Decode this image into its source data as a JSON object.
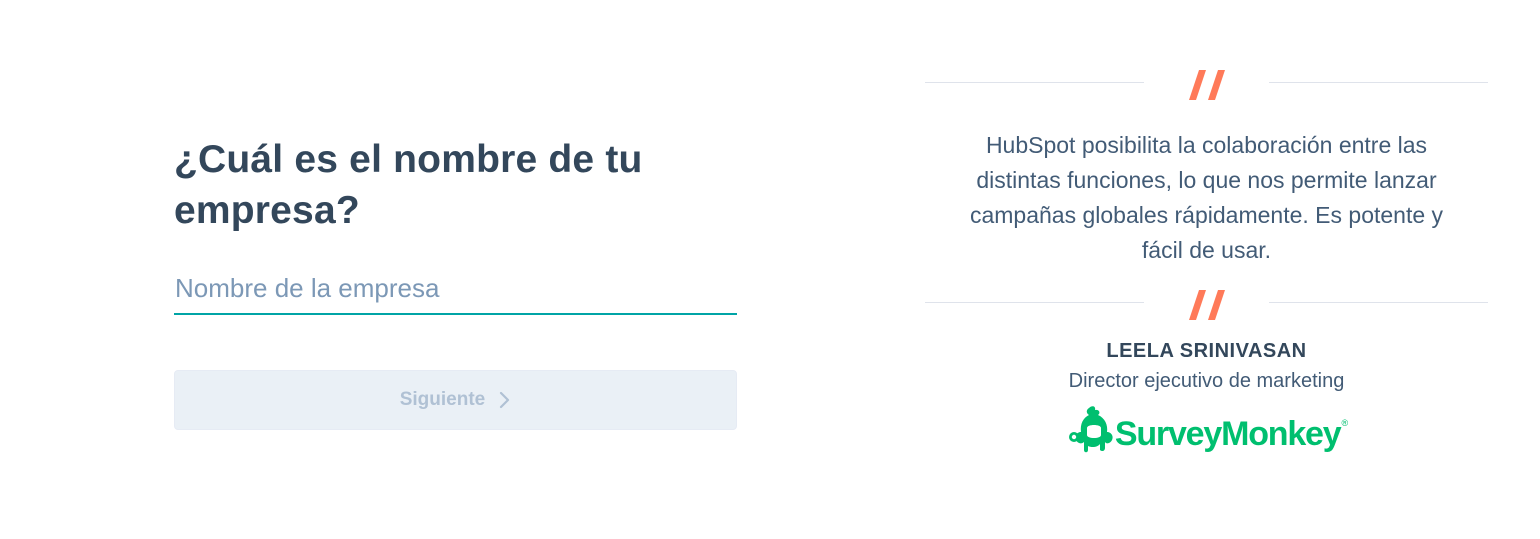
{
  "form": {
    "question": "¿Cuál es el nombre de tu empresa?",
    "company_input": {
      "placeholder": "Nombre de la empresa",
      "value": ""
    },
    "next_button_label": "Siguiente",
    "next_button_state": "disabled"
  },
  "testimonial": {
    "quote": "HubSpot posibilita la colaboración entre las distintas funciones, lo que nos permite lanzar campañas globales rápidamente. Es potente y fácil de usar.",
    "person_name": "LEELA SRINIVASAN",
    "person_role": "Director ejecutivo de marketing",
    "company_logo": {
      "name": "SurveyMonkey",
      "registered_mark": "®",
      "icon": "surveymonkey-monkey-icon"
    },
    "quote_icon": "quote-mark-icon"
  },
  "colors": {
    "heading": "#33475b",
    "input_underline": "#00a4a6",
    "placeholder": "#7c98b6",
    "button_disabled_bg": "#eaf0f6",
    "button_disabled_text": "#b0c1d4",
    "quote_mark": "#ff7a59",
    "divider": "#dfe3eb",
    "brand_green": "#00bf6f"
  }
}
